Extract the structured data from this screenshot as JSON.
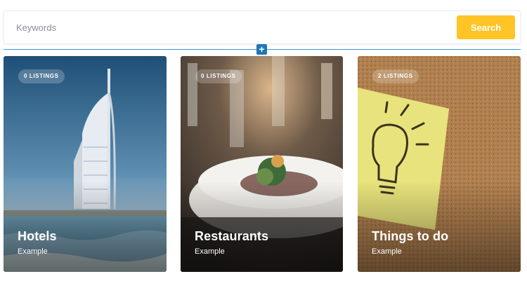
{
  "search": {
    "placeholder": "Keywords",
    "button_label": "Search"
  },
  "editor": {
    "add_section_label": "+"
  },
  "colors": {
    "accent": "#ffc425",
    "divider": "#3a94d1",
    "add_button": "#1f77b8"
  },
  "cards": [
    {
      "badge": "0 LISTINGS",
      "title": "Hotels",
      "subtitle": "Example",
      "image": "burj-al-arab-hotel-photo"
    },
    {
      "badge": "0 LISTINGS",
      "title": "Restaurants",
      "subtitle": "Example",
      "image": "restaurant-dish-photo"
    },
    {
      "badge": "2 LISTINGS",
      "title": "Things to do",
      "subtitle": "Example",
      "image": "lightbulb-sticky-note-photo"
    }
  ]
}
